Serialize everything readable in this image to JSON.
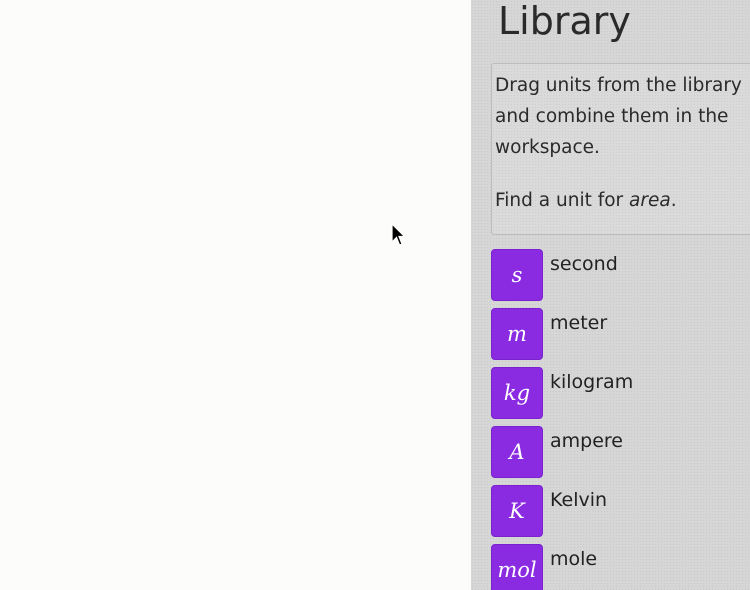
{
  "library": {
    "title": "Library",
    "instructions": {
      "text": "Drag units from the library and combine them in the workspace.",
      "task_prefix": "Find a unit for ",
      "task_quantity": "area",
      "task_suffix": "."
    },
    "units": [
      {
        "symbol": "s",
        "name": "second"
      },
      {
        "symbol": "m",
        "name": "meter"
      },
      {
        "symbol": "kg",
        "name": "kilogram"
      },
      {
        "symbol": "A",
        "name": "ampere"
      },
      {
        "symbol": "K",
        "name": "Kelvin"
      },
      {
        "symbol": "mol",
        "name": "mole"
      }
    ]
  },
  "colors": {
    "unit_tile": "#8a2be2",
    "library_bg": "#d6d6d6",
    "workspace_bg": "#fcfcfa"
  },
  "icons": {
    "cursor": "mouse-pointer-icon"
  }
}
